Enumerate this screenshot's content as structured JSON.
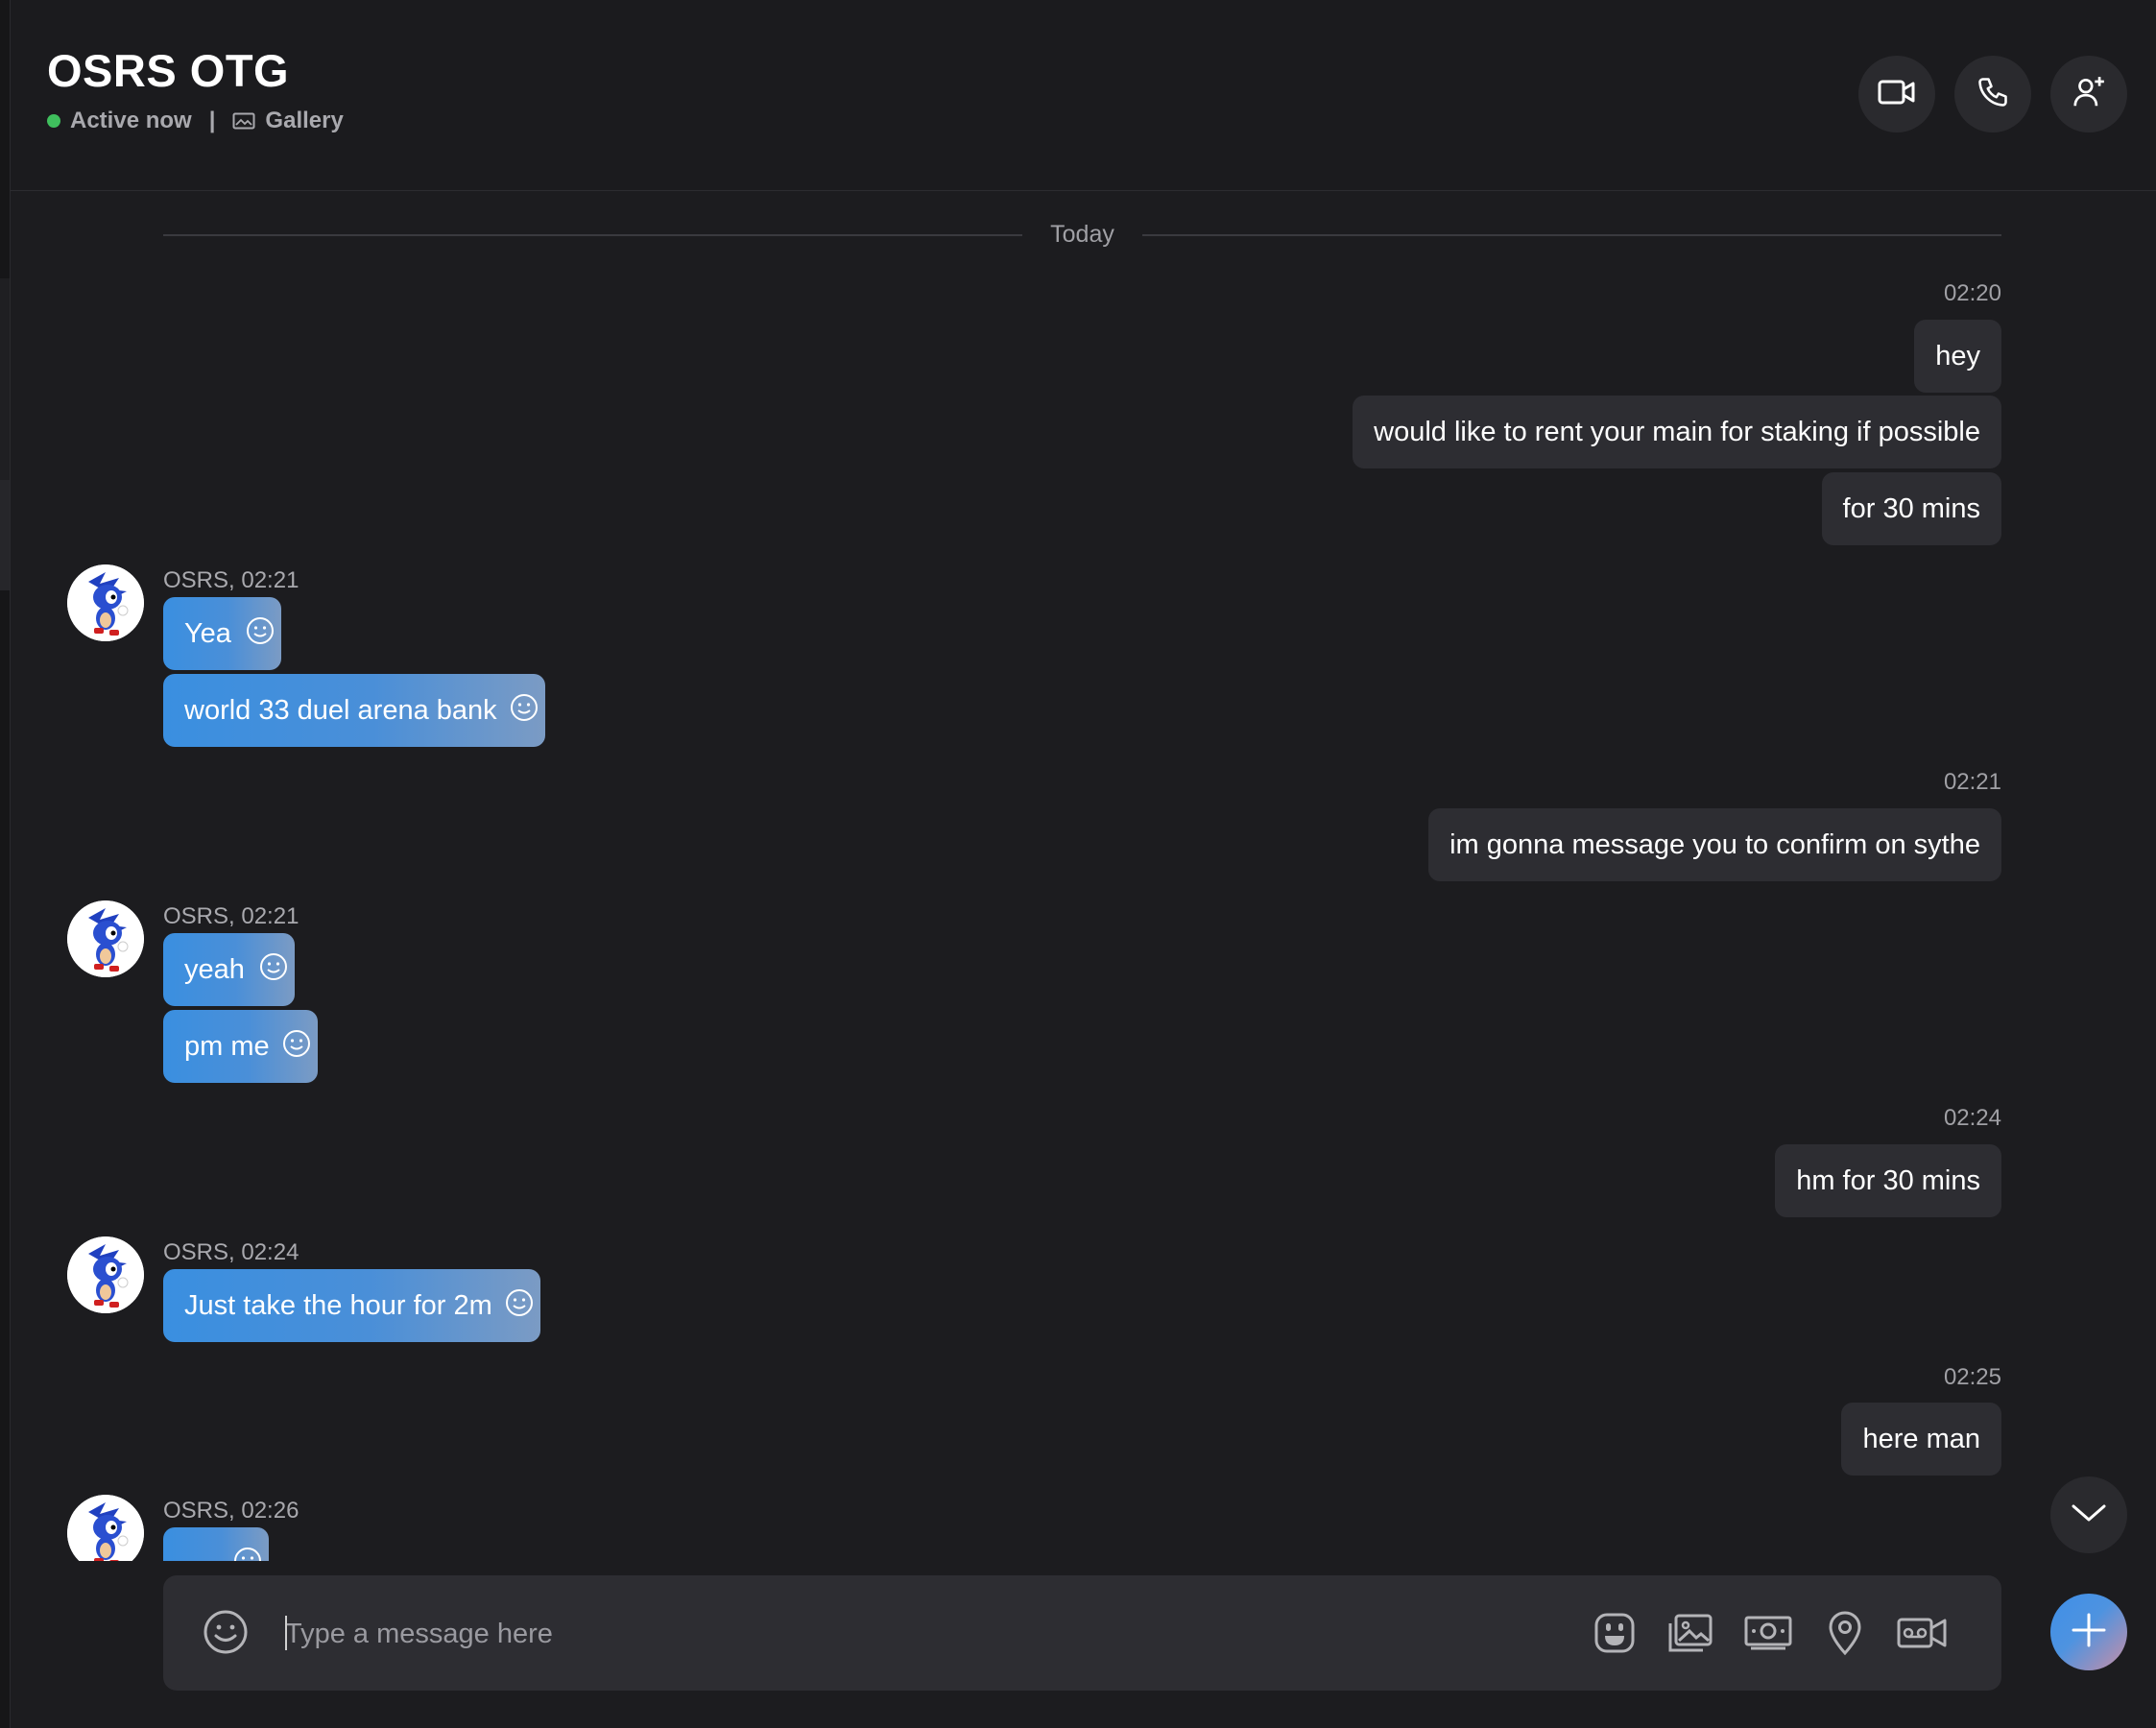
{
  "header": {
    "title": "OSRS OTG",
    "status": "Active now",
    "separator": "|",
    "gallery": "Gallery",
    "buttons": [
      "video-call-icon",
      "phone-icon",
      "add-person-icon"
    ]
  },
  "divider": "Today",
  "messages": {
    "t1": "02:20",
    "m1": "hey",
    "m2": "would like to rent your main for staking if possible",
    "m3": "for 30 mins",
    "s1": "OSRS, 02:21",
    "r1": "Yea",
    "r2": "world 33 duel arena bank",
    "t2": "02:21",
    "m4": "im gonna message you to confirm on sythe",
    "s2": "OSRS, 02:21",
    "r3": "yeah",
    "r4": "pm me",
    "t3": "02:24",
    "m5": "hm for 30 mins",
    "s3": "OSRS, 02:24",
    "r5": "Just take  the hour for 2m",
    "t4": "02:25",
    "m6": "here man",
    "s4": "OSRS, 02:26"
  },
  "composer": {
    "placeholder": "Type a message here",
    "tools": [
      "sticker-icon",
      "image-icon",
      "money-icon",
      "location-icon",
      "video-message-icon"
    ]
  },
  "colors": {
    "background": "#1c1c1f",
    "outgoing_bubble": "#2d2d32",
    "incoming_bubble_start": "#3a8fe0",
    "incoming_bubble_end": "#7b9bc4",
    "online": "#3fbf5d"
  }
}
